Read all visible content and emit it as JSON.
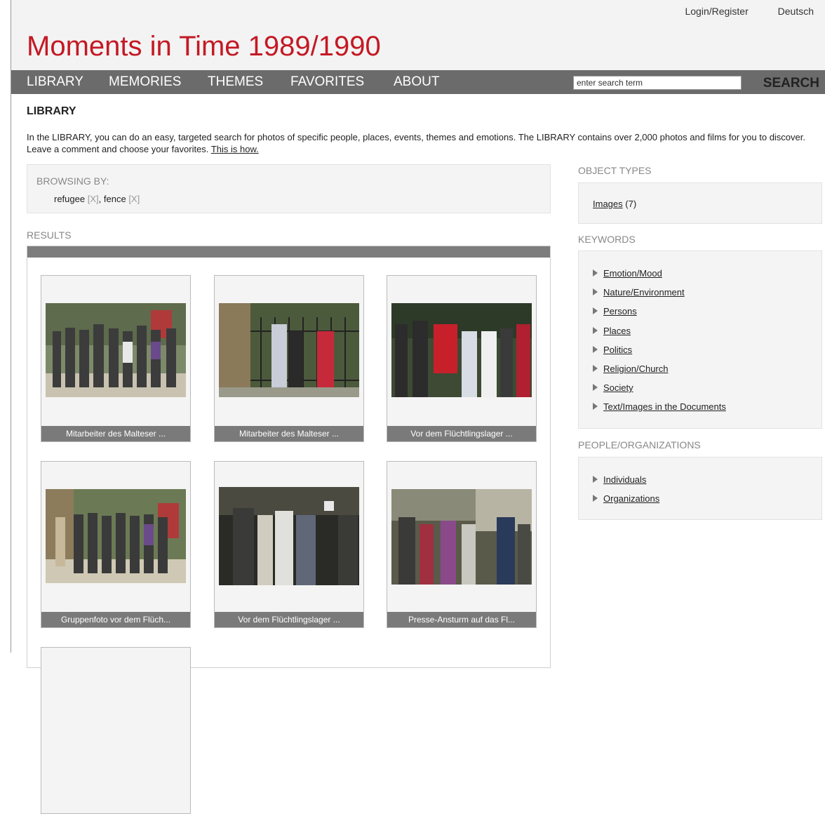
{
  "header": {
    "login_label": "Login/Register",
    "language_label": "Deutsch",
    "site_title": "Moments in Time 1989/1990"
  },
  "nav": {
    "items": [
      {
        "label": "LIBRARY"
      },
      {
        "label": "MEMORIES"
      },
      {
        "label": "THEMES"
      },
      {
        "label": "FAVORITES"
      },
      {
        "label": "ABOUT"
      }
    ],
    "search_value": "enter search term",
    "search_label": "SEARCH"
  },
  "library": {
    "heading": "LIBRARY",
    "intro": "In the LIBRARY, you can do an easy, targeted search for photos of specific people, places, events, themes and emotions. The LIBRARY contains over 2,000 photos and films for you to discover. Leave a comment and choose your favorites.",
    "howto_link": "This is how."
  },
  "browsing": {
    "label": "BROWSING BY:",
    "terms": [
      {
        "term": "refugee",
        "remove": "[X]"
      },
      {
        "term": "fence",
        "remove": "[X]"
      }
    ],
    "separator": ","
  },
  "results": {
    "label": "RESULTS",
    "items": [
      {
        "caption": "Mitarbeiter des Malteser ..."
      },
      {
        "caption": "Mitarbeiter des Malteser ..."
      },
      {
        "caption": "Vor dem Flüchtlingslager ..."
      },
      {
        "caption": "Gruppenfoto vor dem Flüch..."
      },
      {
        "caption": "Vor dem Flüchtlingslager ..."
      },
      {
        "caption": "Presse-Ansturm auf das Fl..."
      }
    ]
  },
  "sidebar": {
    "object_types": {
      "heading": "OBJECT TYPES",
      "items": [
        {
          "label": "Images",
          "count": "(7)"
        }
      ]
    },
    "keywords": {
      "heading": "KEYWORDS",
      "items": [
        {
          "label": "Emotion/Mood"
        },
        {
          "label": "Nature/Environment"
        },
        {
          "label": "Persons"
        },
        {
          "label": "Places"
        },
        {
          "label": "Politics"
        },
        {
          "label": "Religion/Church"
        },
        {
          "label": "Society"
        },
        {
          "label": "Text/Images in the Documents"
        }
      ]
    },
    "people": {
      "heading": "PEOPLE/ORGANIZATIONS",
      "items": [
        {
          "label": "Individuals"
        },
        {
          "label": "Organizations"
        }
      ]
    }
  },
  "colors": {
    "brand_red": "#c41924",
    "nav_gray": "#6b6b6b",
    "caption_gray": "#7a7a7a"
  }
}
